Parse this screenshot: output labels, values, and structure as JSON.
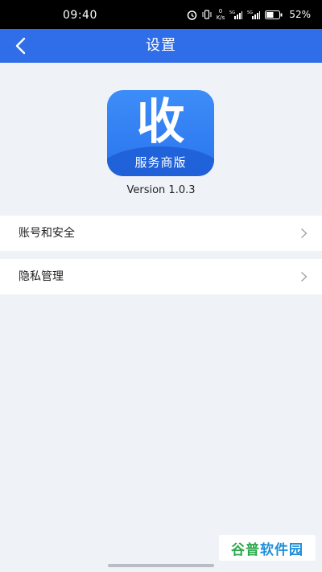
{
  "status_bar": {
    "time": "09:40",
    "net_speed_value": "0",
    "net_speed_unit": "K/s",
    "signal_1_label": "5G",
    "signal_2_label": "5G",
    "battery_percent": "52%"
  },
  "app_bar": {
    "title": "设置",
    "back_icon": "chevron-left-icon"
  },
  "logo": {
    "glyph": "收",
    "caption": "服务商版",
    "colors": {
      "top": "#3d8df8",
      "bottom": "#2a74ee"
    }
  },
  "version": "Version 1.0.3",
  "menu": [
    {
      "label": "账号和安全",
      "icon": "chevron-right-icon"
    },
    {
      "label": "隐私管理",
      "icon": "chevron-right-icon"
    }
  ],
  "watermark": {
    "part1": "谷普",
    "part2": "软件园"
  },
  "colors": {
    "accent": "#2f6ee8",
    "background": "#eff2f6"
  }
}
